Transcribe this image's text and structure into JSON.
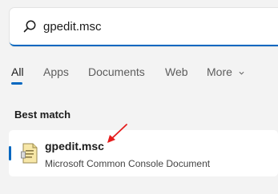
{
  "search": {
    "value": "gpedit.msc",
    "icon": "search-icon",
    "accent_color": "#0067c0"
  },
  "tabs": [
    {
      "label": "All",
      "active": true
    },
    {
      "label": "Apps"
    },
    {
      "label": "Documents"
    },
    {
      "label": "Web"
    },
    {
      "label": "More"
    }
  ],
  "best_match": {
    "title": "Best match",
    "result": {
      "name": "gpedit.msc",
      "description": "Microsoft Common Console Document",
      "icon": "msc-file-icon"
    }
  },
  "annotation": {
    "arrow_color": "#e51c1c"
  }
}
